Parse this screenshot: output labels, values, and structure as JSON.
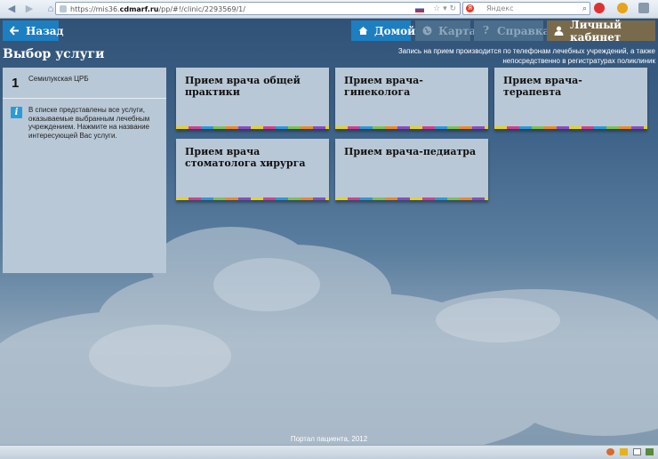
{
  "browser": {
    "url_prefix": "https://mis36.",
    "url_domain": "cdmarf.ru",
    "url_suffix": "/pp/#!/clinic/2293569/1/",
    "search_placeholder": "Яндекс"
  },
  "nav": {
    "back_label": "Назад",
    "home_label": "Домой",
    "map_label": "Карта",
    "help_label": "Справка",
    "cabinet_label": "Личный кабинет"
  },
  "page": {
    "title": "Выбор услуги",
    "notice": "Запись на прием производится по телефонам лечебных учреждений, а также непосредственно в регистратурах поликлиник"
  },
  "sidebar": {
    "step_number": "1",
    "step_label": "Семилукская ЦРБ",
    "info_text": "В списке представлены все услуги, оказываемые выбранным лечебным учреждением. Нажмите на название интересующей Вас услуги."
  },
  "services": [
    {
      "label": "Прием врача общей практики"
    },
    {
      "label": "Прием врача-гинеколога"
    },
    {
      "label": "Прием врача-терапевта"
    },
    {
      "label": "Прием врача стоматолога хирурга"
    },
    {
      "label": "Прием врача-педиатра"
    }
  ],
  "footer": {
    "text": "Портал пациента, 2012"
  },
  "colors": {
    "primary_button": "#1d7ec0",
    "disabled_button": "#4a6e8c",
    "cabinet_button": "#7a6a4c",
    "panel": "#b9c8d6"
  }
}
